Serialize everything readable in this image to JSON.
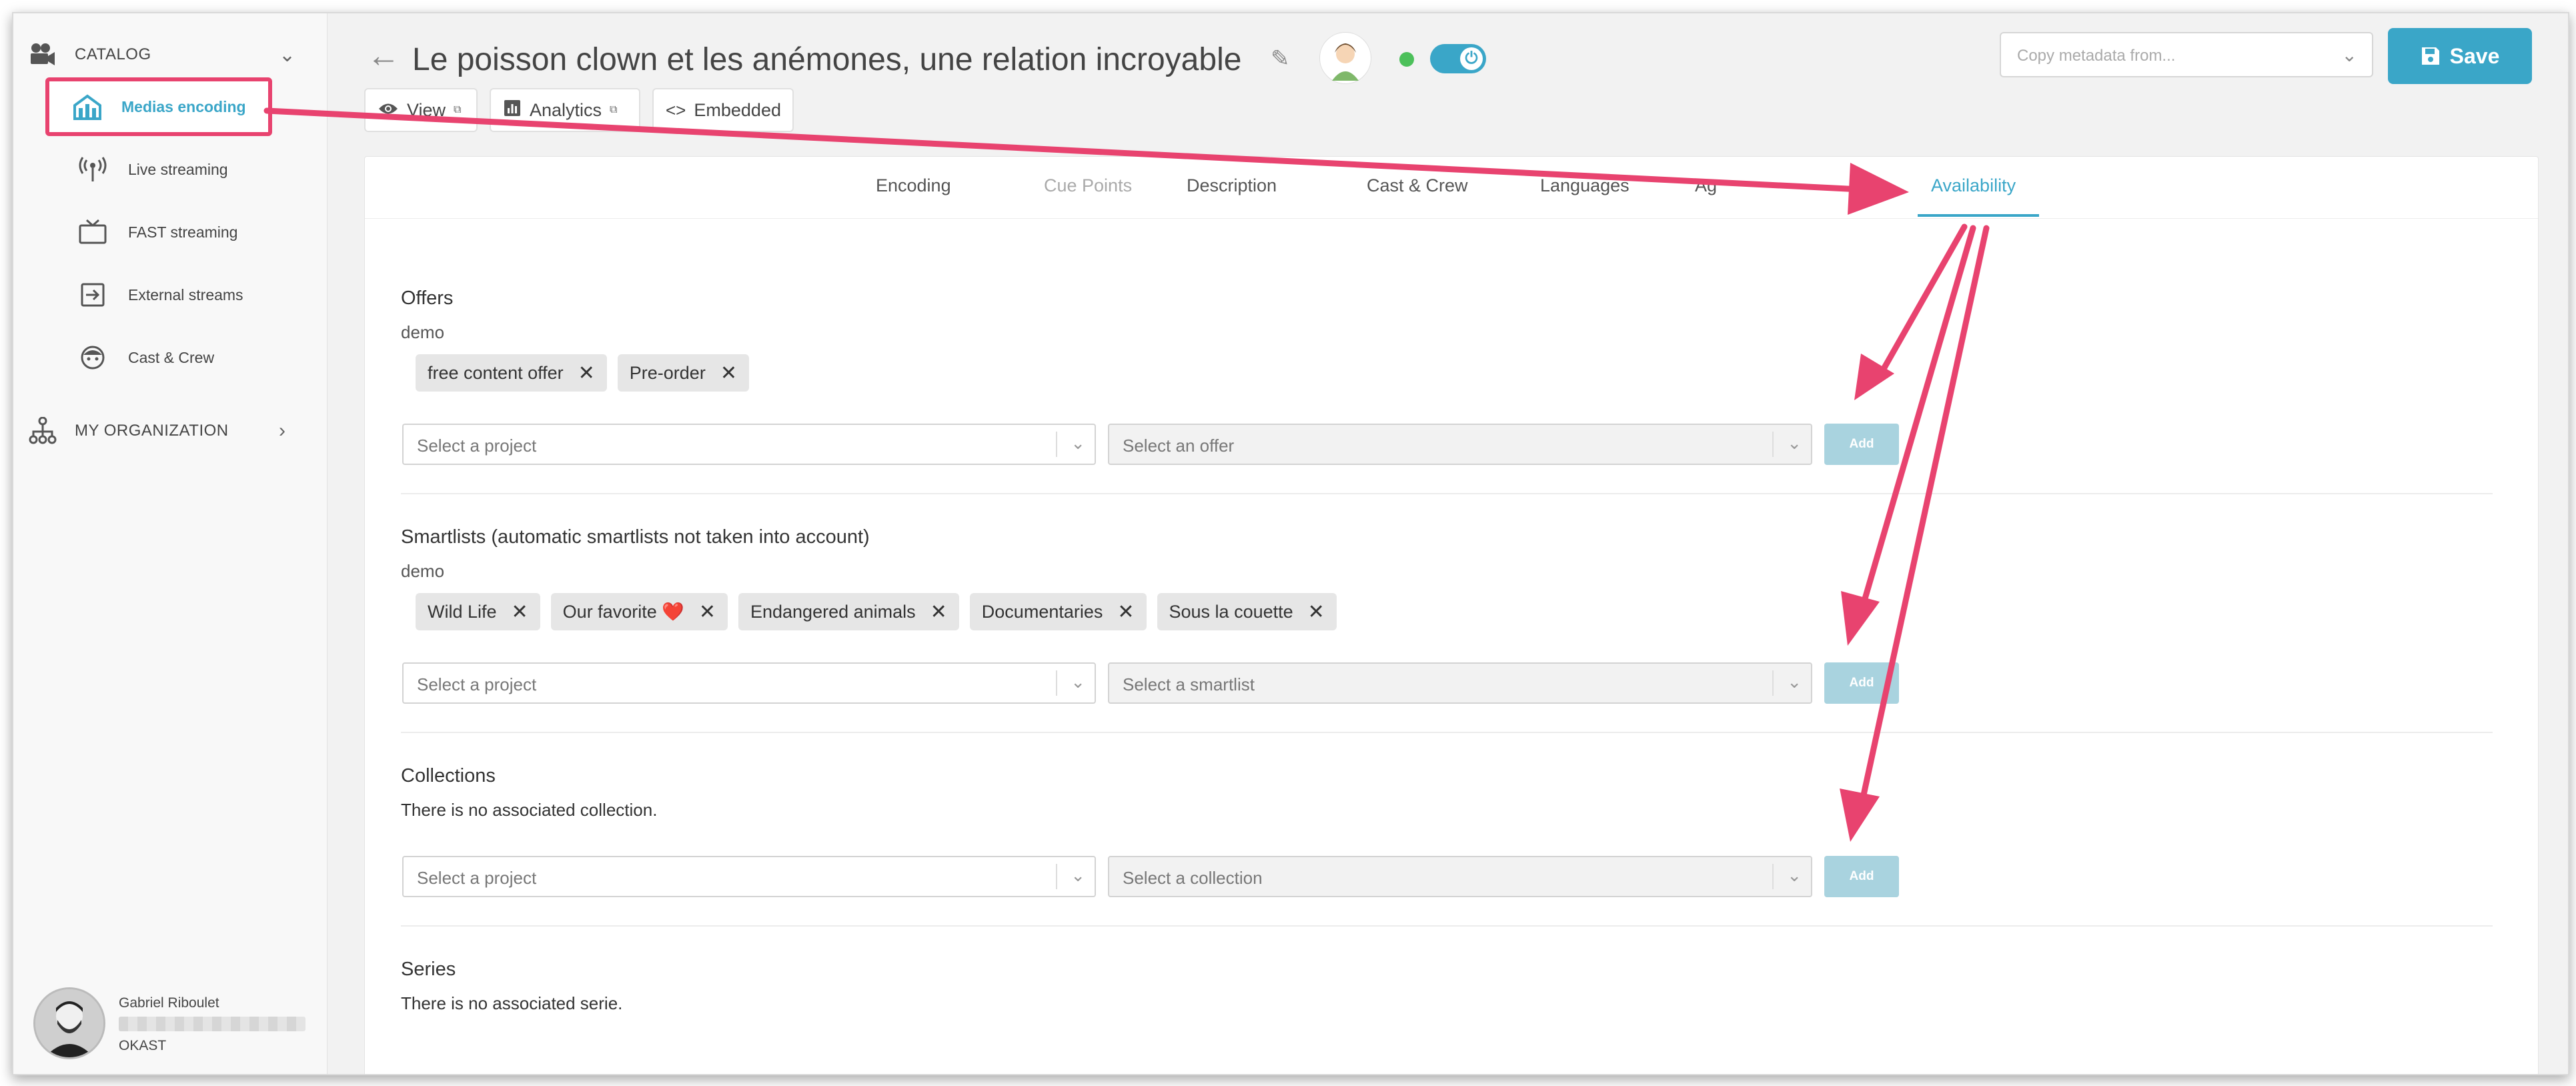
{
  "sidebar": {
    "catalog_label": "CATALOG",
    "items": [
      {
        "label": "Medias encoding",
        "icon": "house-icon"
      },
      {
        "label": "Live streaming",
        "icon": "antenna-icon"
      },
      {
        "label": "FAST streaming",
        "icon": "tv-icon"
      },
      {
        "label": "External streams",
        "icon": "external-stream-icon"
      },
      {
        "label": "Cast & Crew",
        "icon": "face-icon"
      }
    ],
    "organization_label": "MY ORGANIZATION",
    "user": {
      "name": "Gabriel Riboulet",
      "org": "OKAST"
    }
  },
  "header": {
    "back_icon": "←",
    "title": "Le poisson clown et les anémones, une relation incroyable",
    "copy_placeholder": "Copy metadata from...",
    "save_label": "Save",
    "status_color": "#4cc05a",
    "buttons": [
      {
        "label": "View"
      },
      {
        "label": "Analytics"
      },
      {
        "label": "Embedded"
      }
    ]
  },
  "tabs": [
    "Encoding",
    "Cue Points",
    "Description",
    "Cast & Crew",
    "Languages",
    "Ag",
    "Availability"
  ],
  "offers": {
    "title": "Offers",
    "project": "demo",
    "tags": [
      "free content offer",
      "Pre-order"
    ],
    "project_placeholder": "Select a project",
    "item_placeholder": "Select an offer",
    "add_label": "Add"
  },
  "smartlists": {
    "title": "Smartlists (automatic smartlists not taken into account)",
    "project": "demo",
    "tags": [
      "Wild Life",
      "Our favorite ❤️",
      "Endangered animals",
      "Documentaries",
      "Sous la couette"
    ],
    "project_placeholder": "Select a project",
    "item_placeholder": "Select a smartlist",
    "add_label": "Add"
  },
  "collections": {
    "title": "Collections",
    "empty_text": "There is no associated collection.",
    "project_placeholder": "Select a project",
    "item_placeholder": "Select a collection",
    "add_label": "Add"
  },
  "series": {
    "title": "Series",
    "empty_text": "There is no associated serie."
  },
  "colors": {
    "accent": "#3aa6c8",
    "annotation": "#e8436f"
  }
}
